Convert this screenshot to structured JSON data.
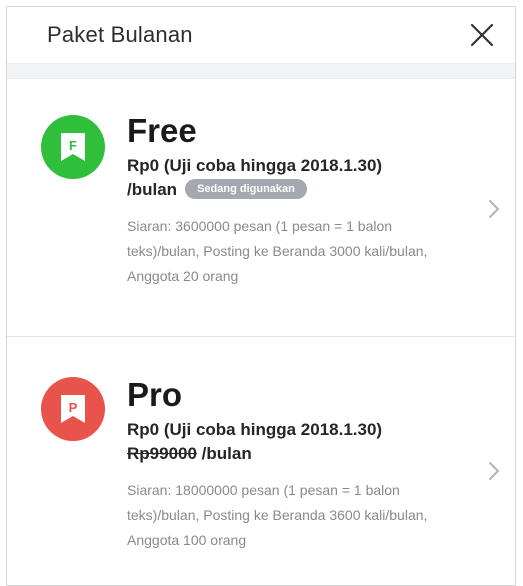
{
  "header": {
    "title": "Paket Bulanan"
  },
  "plans": [
    {
      "name": "Free",
      "icon_letter": "F",
      "icon_color": "#2fbf3b",
      "price_line1": "Rp0 (Uji coba hingga 2018.1.30)",
      "price_line2": "/bulan",
      "badge": "Sedang digunakan",
      "description": "Siaran: 3600000 pesan (1 pesan = 1 balon teks)/bulan, Posting ke Beranda 3000 kali/bulan, Anggota 20 orang"
    },
    {
      "name": "Pro",
      "icon_letter": "P",
      "icon_color": "#e8534c",
      "price_line1": "Rp0 (Uji coba hingga 2018.1.30)",
      "old_price": "Rp99000",
      "price_line2": " /bulan",
      "description": "Siaran: 18000000 pesan (1 pesan = 1 balon teks)/bulan, Posting ke Beranda 3600 kali/bulan, Anggota 100 orang"
    }
  ],
  "icons": {
    "close": "close-icon",
    "chevron": "chevron-right-icon",
    "plan_badge": "bookmark-icon"
  }
}
